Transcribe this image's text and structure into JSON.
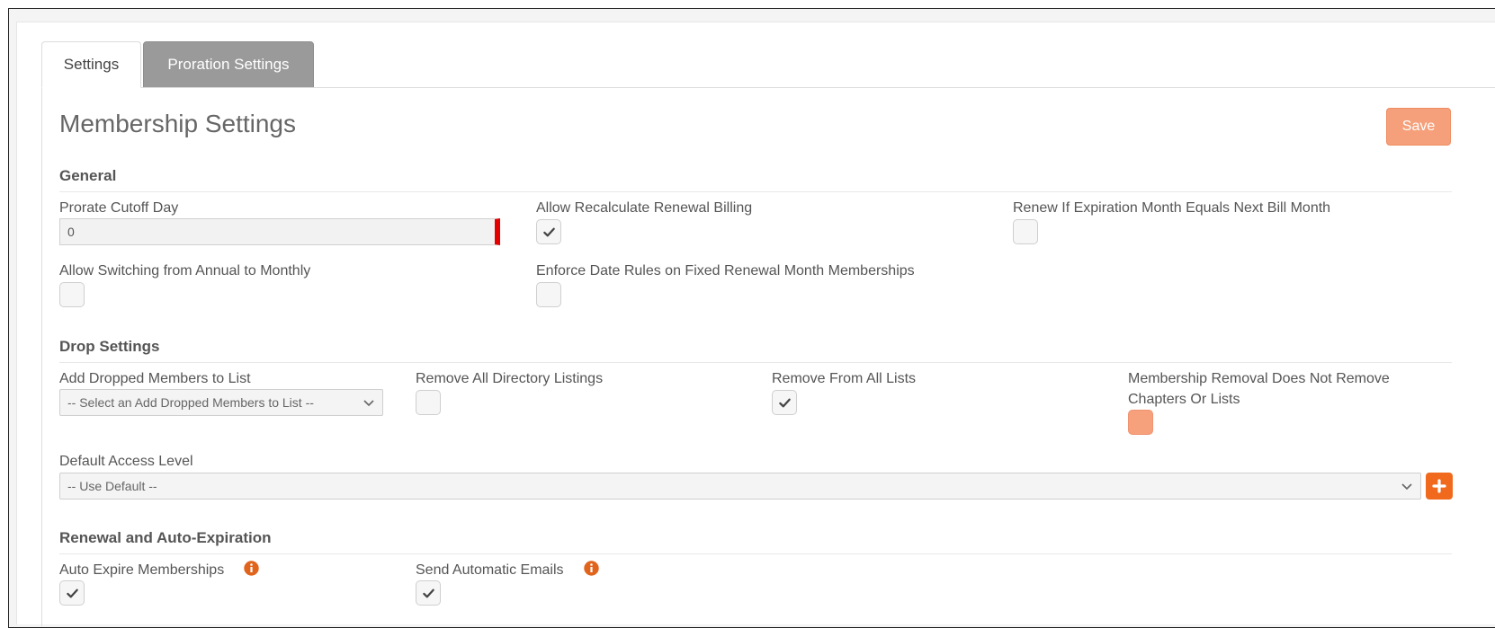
{
  "tabs": {
    "settings": "Settings",
    "proration": "Proration Settings"
  },
  "page": {
    "title": "Membership Settings",
    "save_label": "Save"
  },
  "sections": {
    "general": "General",
    "drop": "Drop Settings",
    "renewal": "Renewal and Auto-Expiration"
  },
  "general": {
    "prorate_label": "Prorate Cutoff Day",
    "prorate_value": "0",
    "allow_recalc_label": "Allow Recalculate Renewal Billing",
    "allow_recalc_checked": true,
    "renew_if_label": "Renew If Expiration Month Equals Next Bill Month",
    "renew_if_checked": false,
    "allow_switch_label": "Allow Switching from Annual to Monthly",
    "allow_switch_checked": false,
    "enforce_label": "Enforce Date Rules on Fixed Renewal Month Memberships",
    "enforce_checked": false
  },
  "drop": {
    "add_dropped_label": "Add Dropped Members to List",
    "add_dropped_selected": "-- Select an Add Dropped Members to List --",
    "remove_directory_label": "Remove All Directory Listings",
    "remove_directory_checked": false,
    "remove_lists_label": "Remove From All Lists",
    "remove_lists_checked": true,
    "removal_line1": "Membership Removal Does Not Remove",
    "removal_line2": "Chapters Or Lists",
    "removal_checked": false,
    "default_access_label": "Default Access Level",
    "default_access_selected": "-- Use Default --"
  },
  "renewal": {
    "auto_expire_label": "Auto Expire Memberships",
    "auto_expire_checked": true,
    "send_emails_label": "Send Automatic Emails",
    "send_emails_checked": true
  },
  "icons": {
    "check": "check-icon",
    "chevron": "chevron-down-icon",
    "plus": "plus-icon",
    "info": "info-icon"
  },
  "colors": {
    "accent_orange": "#f5a07a",
    "plus_orange": "#f0691c",
    "info_orange": "#e0641c",
    "invalid_red": "#e50000",
    "tab_active_gray": "#9a9a9a"
  }
}
